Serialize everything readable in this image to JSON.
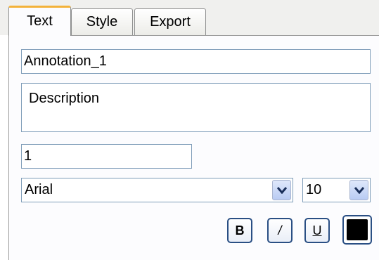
{
  "tabs": [
    {
      "label": "Text",
      "active": true
    },
    {
      "label": "Style",
      "active": false
    },
    {
      "label": "Export",
      "active": false
    }
  ],
  "form": {
    "name_value": "Annotation_1",
    "description_value": "Description",
    "number_value": "1",
    "font_family_value": "Arial",
    "font_size_value": "10"
  },
  "format": {
    "bold_label": "B",
    "italic_label": "/",
    "underline_label": "U",
    "text_color": "#000000"
  },
  "colors": {
    "active_tab_accent": "#f3b23a",
    "field_border": "#7f9db9",
    "button_border": "#2a4f84"
  },
  "icons": {
    "dropdown": "chevron-down-icon"
  }
}
